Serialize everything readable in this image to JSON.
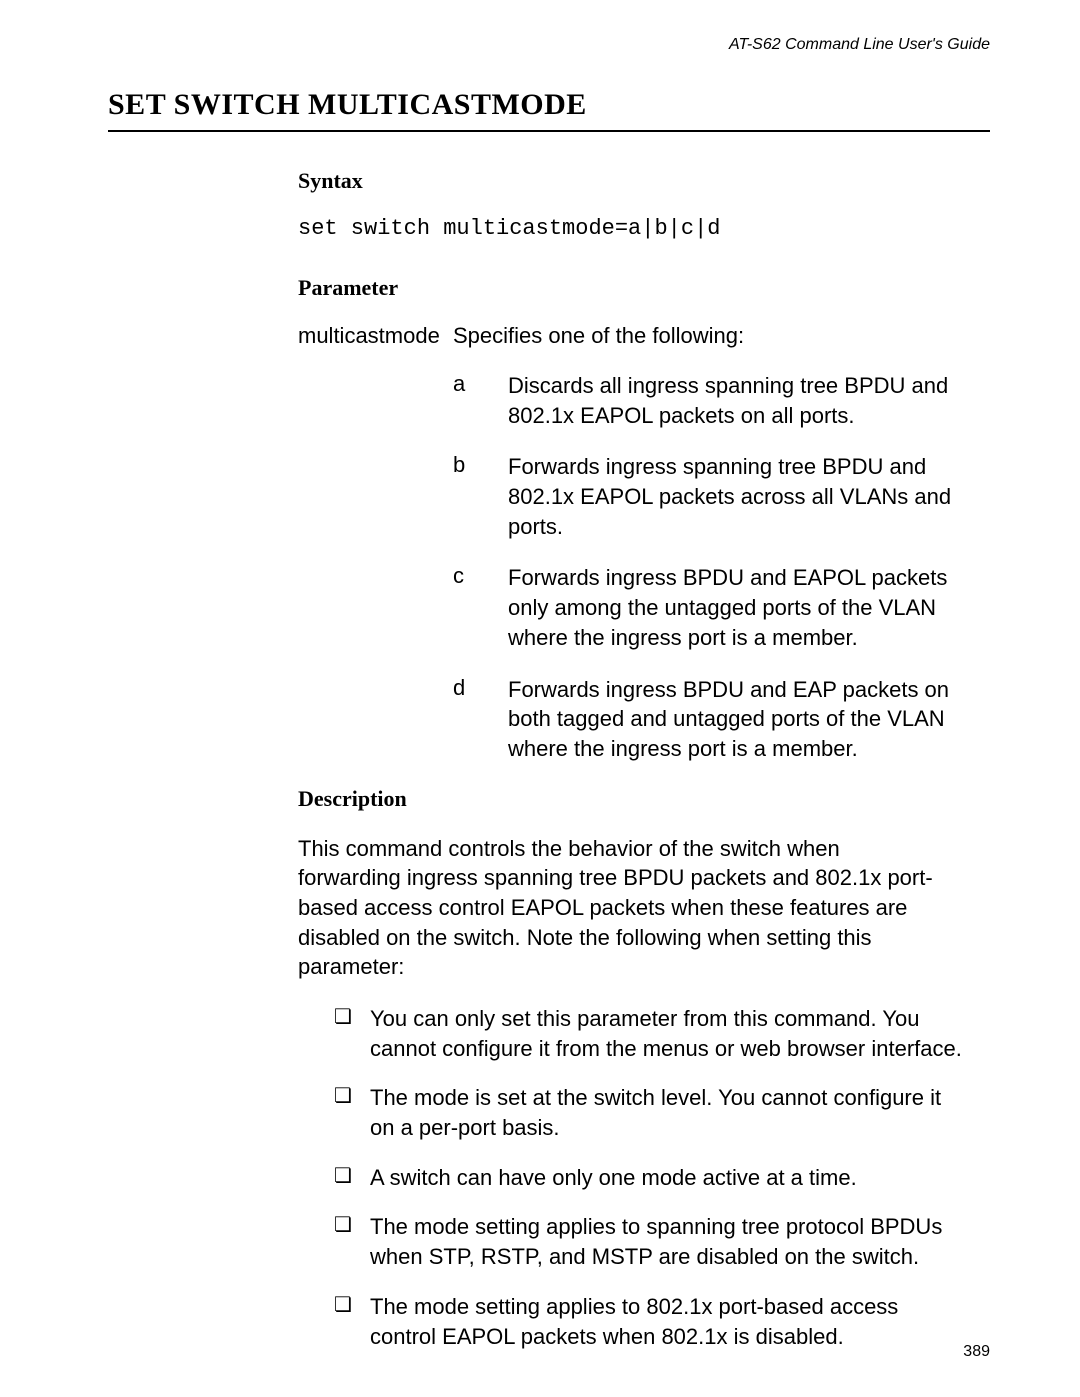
{
  "header": {
    "running_title": "AT-S62 Command Line User's Guide"
  },
  "title": "SET SWITCH MULTICASTMODE",
  "sections": {
    "syntax": {
      "heading": "Syntax",
      "code": "set switch multicastmode=a|b|c|d"
    },
    "parameter": {
      "heading": "Parameter",
      "name": "multicastmode",
      "intro": "Specifies one of the following:",
      "options": [
        {
          "key": "a",
          "text": "Discards all ingress spanning tree BPDU and 802.1x EAPOL packets on all ports."
        },
        {
          "key": "b",
          "text": "Forwards ingress spanning tree BPDU and 802.1x EAPOL packets across all VLANs and ports."
        },
        {
          "key": "c",
          "text": "Forwards ingress BPDU and EAPOL packets only among the untagged ports of the VLAN where the ingress port is a member."
        },
        {
          "key": "d",
          "text": "Forwards ingress BPDU and EAP packets on both tagged and untagged ports of the VLAN where the ingress port is a member."
        }
      ]
    },
    "description": {
      "heading": "Description",
      "para": "This command controls the behavior of the switch when forwarding ingress spanning tree BPDU packets and 802.1x port-based access control EAPOL packets when these features are disabled on the switch. Note the following when setting this parameter:",
      "bullets": [
        "You can only set this parameter from this command. You cannot configure it from the menus or web browser interface.",
        "The mode is set at the switch level. You cannot configure it on a per-port basis.",
        "A switch can have only one mode active at a time.",
        "The mode setting applies to spanning tree protocol BPDUs when STP, RSTP, and MSTP are disabled on the switch.",
        "The mode setting applies to 802.1x port-based access control EAPOL packets when 802.1x is disabled."
      ]
    }
  },
  "footer": {
    "page_number": "389"
  }
}
